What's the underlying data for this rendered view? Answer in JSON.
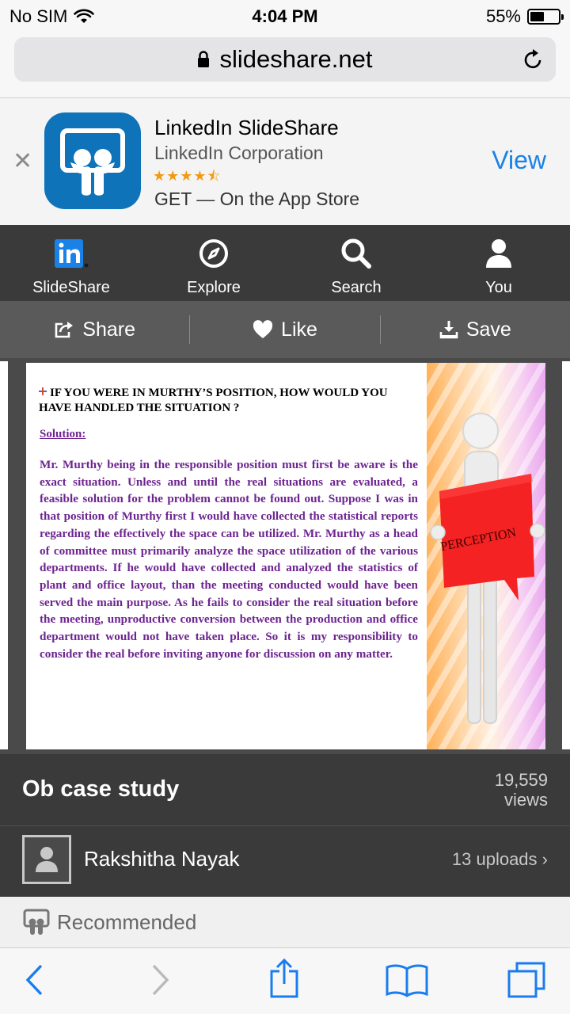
{
  "status_bar": {
    "carrier": "No SIM",
    "time": "4:04 PM",
    "battery_percent": "55%",
    "battery_level": 0.55
  },
  "browser": {
    "url": "slideshare.net"
  },
  "app_banner": {
    "app_name": "LinkedIn SlideShare",
    "developer": "LinkedIn Corporation",
    "stars": "★★★★⯪",
    "rating": 4.5,
    "get_text": "GET — On the App Store",
    "view_label": "View"
  },
  "nav": {
    "items": [
      {
        "label": "SlideShare",
        "icon": "linkedin-icon"
      },
      {
        "label": "Explore",
        "icon": "compass-icon"
      },
      {
        "label": "Search",
        "icon": "search-icon"
      },
      {
        "label": "You",
        "icon": "user-icon"
      }
    ]
  },
  "actions": {
    "share": "Share",
    "like": "Like",
    "save": "Save"
  },
  "slide": {
    "question": "IF YOU WERE IN MURTHY’S POSITION, HOW WOULD YOU HAVE HANDLED THE SITUATION ?",
    "solution_label": "Solution:",
    "body": "Mr. Murthy being in the responsible position must first be aware is the exact situation. Unless and until the real situations are evaluated, a feasible solution for the problem cannot be found out. Suppose I was in that position of Murthy first I would have collected the statistical reports regarding the effectively the space can be utilized. Mr. Murthy as a head of committee must primarily analyze the space utilization of the various departments. If he would have collected and analyzed the statistics of plant and office layout, than the meeting conducted would have been served the main purpose. As he fails to consider the real situation before the meeting, unproductive conversion between the production and office department would not have taken place. So it is my responsibility to consider the real before inviting anyone for discussion on any matter.",
    "sign_text": "PERCEPTION"
  },
  "presentation": {
    "title": "Ob case study",
    "views_count": "19,559",
    "views_label": "views",
    "author": "Rakshitha Nayak",
    "uploads": "13 uploads"
  },
  "recommended": {
    "label": "Recommended"
  },
  "colors": {
    "nav_bg": "#3a3a3a",
    "action_bg": "#5a5a5a",
    "link_blue": "#1a82e6",
    "slide_text": "#6d2490",
    "sign_red": "#f42222"
  }
}
